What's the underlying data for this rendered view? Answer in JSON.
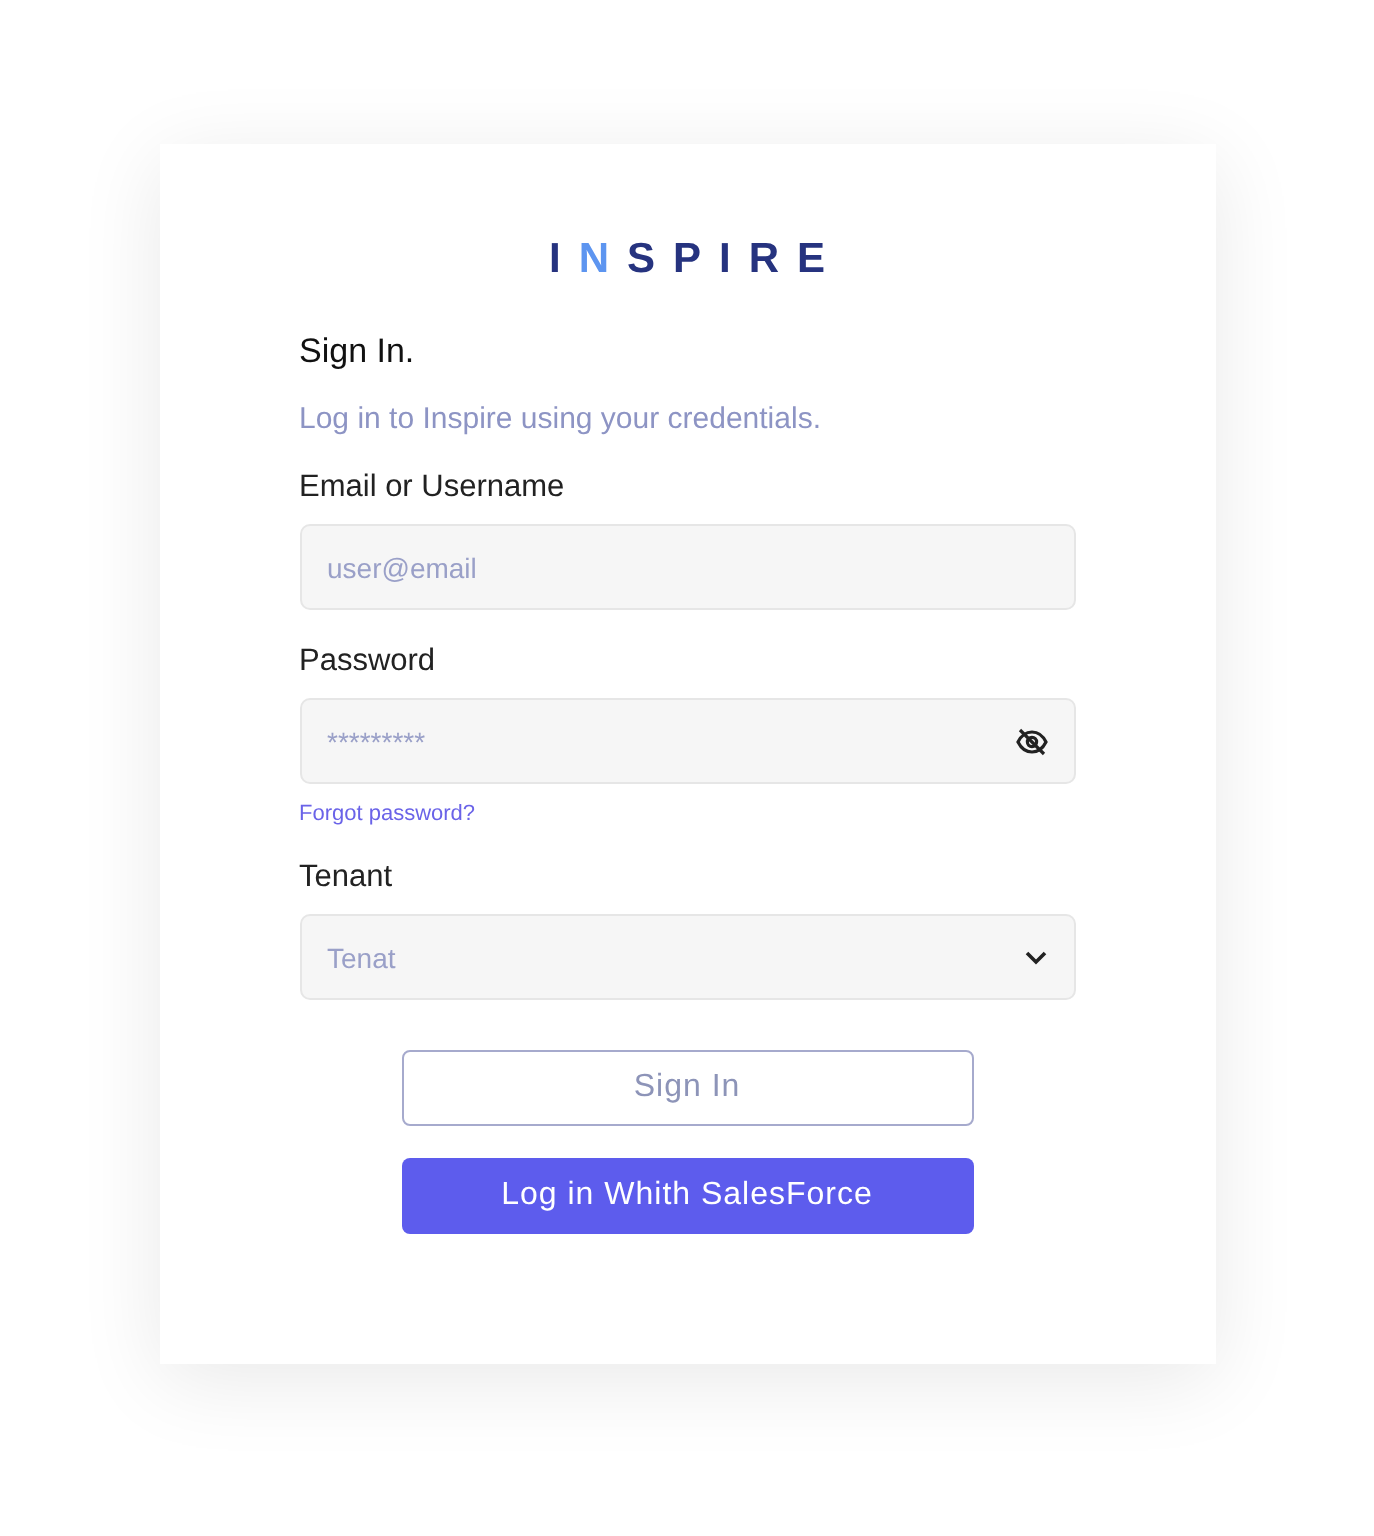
{
  "logo": {
    "parts": [
      {
        "text": "I",
        "color": "#26337f"
      },
      {
        "text": "N",
        "color": "#5d95f0"
      },
      {
        "text": "SPIRE",
        "color": "#26337f"
      }
    ]
  },
  "heading": "Sign In.",
  "subtitle": "Log in to Inspire using your credentials.",
  "fields": [
    {
      "kind": "text",
      "label": "Email or Username",
      "placeholder": "user@email"
    },
    {
      "kind": "password",
      "label": "Password",
      "placeholder": "*********",
      "link": "Forgot password?"
    },
    {
      "kind": "select",
      "label": "Tenant",
      "placeholder": "Tenat"
    }
  ],
  "buttons": [
    {
      "kind": "outline",
      "label": "Sign In"
    },
    {
      "kind": "primary",
      "label": "Log in Whith SalesForce"
    }
  ]
}
